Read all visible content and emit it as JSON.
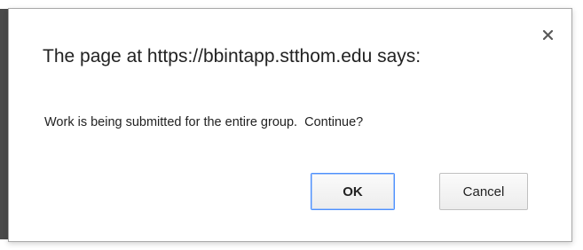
{
  "dialog": {
    "title": "The page at https://bbintapp.stthom.edu says:",
    "message": "Work is being submitted for the entire group.  Continue?",
    "close_icon": "close-icon",
    "ok_label": "OK",
    "cancel_label": "Cancel"
  },
  "colors": {
    "focus_border": "#4d90fe",
    "text": "#222222",
    "dialog_border": "#a8a8a8"
  }
}
